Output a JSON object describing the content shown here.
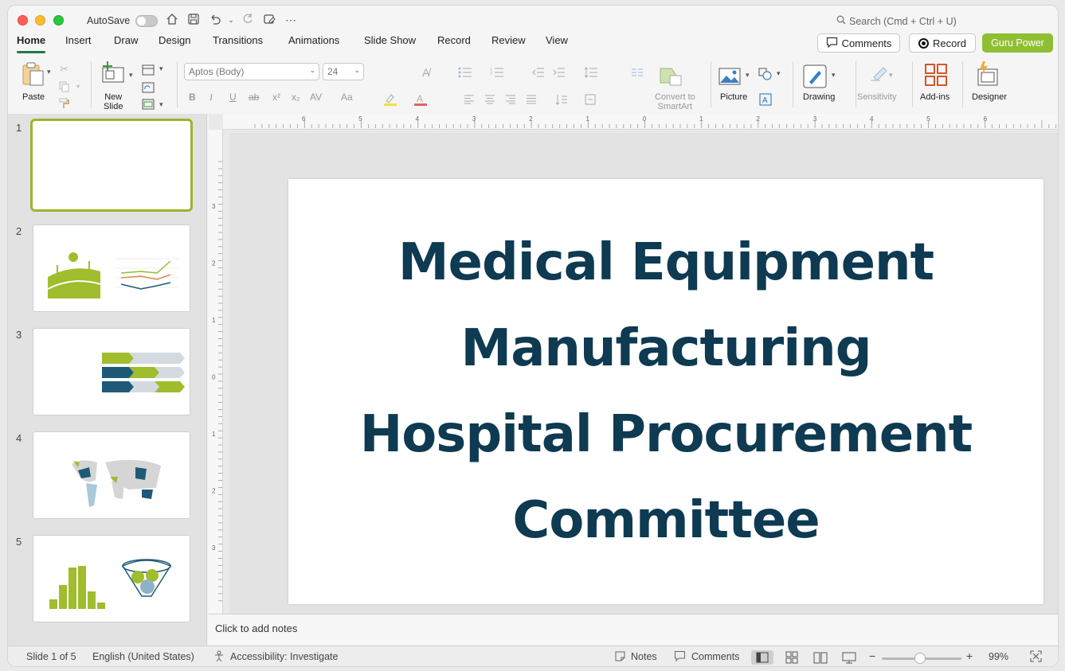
{
  "titlebar": {
    "autosave_label": "AutoSave",
    "search_placeholder": "Search (Cmd + Ctrl + U)"
  },
  "menu_tabs": [
    "Home",
    "Insert",
    "Draw",
    "Design",
    "Transitions",
    "Animations",
    "Slide Show",
    "Record",
    "Review",
    "View"
  ],
  "active_tab": "Home",
  "header_buttons": {
    "comments": "Comments",
    "record": "Record",
    "guru": "Guru Power",
    "guru_color": "#8fbf32"
  },
  "ribbon": {
    "paste": "Paste",
    "new_slide": "New\nSlide",
    "font_name": "Aptos (Body)",
    "font_size": "24",
    "convert_smartart": "Convert to\nSmartArt",
    "picture": "Picture",
    "drawing": "Drawing",
    "sensitivity": "Sensitivity",
    "addins": "Add-ins",
    "designer": "Designer"
  },
  "thumbnails": [
    {
      "num": "1",
      "selected": true
    },
    {
      "num": "2",
      "selected": false
    },
    {
      "num": "3",
      "selected": false
    },
    {
      "num": "4",
      "selected": false
    },
    {
      "num": "5",
      "selected": false
    }
  ],
  "slide": {
    "title_lines": [
      "Medical Equipment",
      "Manufacturing",
      "Hospital Procurement",
      "Committee"
    ],
    "title_color": "#0e3a52"
  },
  "ruler_top_labels": [
    "6",
    "5",
    "4",
    "3",
    "2",
    "1",
    "0",
    "1",
    "2",
    "3",
    "4",
    "5",
    "6"
  ],
  "ruler_left_labels": [
    "3",
    "2",
    "1",
    "0",
    "1",
    "2",
    "3"
  ],
  "notes_placeholder": "Click to add notes",
  "status": {
    "slide_count": "Slide 1 of 5",
    "language": "English (United States)",
    "accessibility": "Accessibility: Investigate",
    "notes": "Notes",
    "comments": "Comments",
    "zoom": "99%"
  }
}
